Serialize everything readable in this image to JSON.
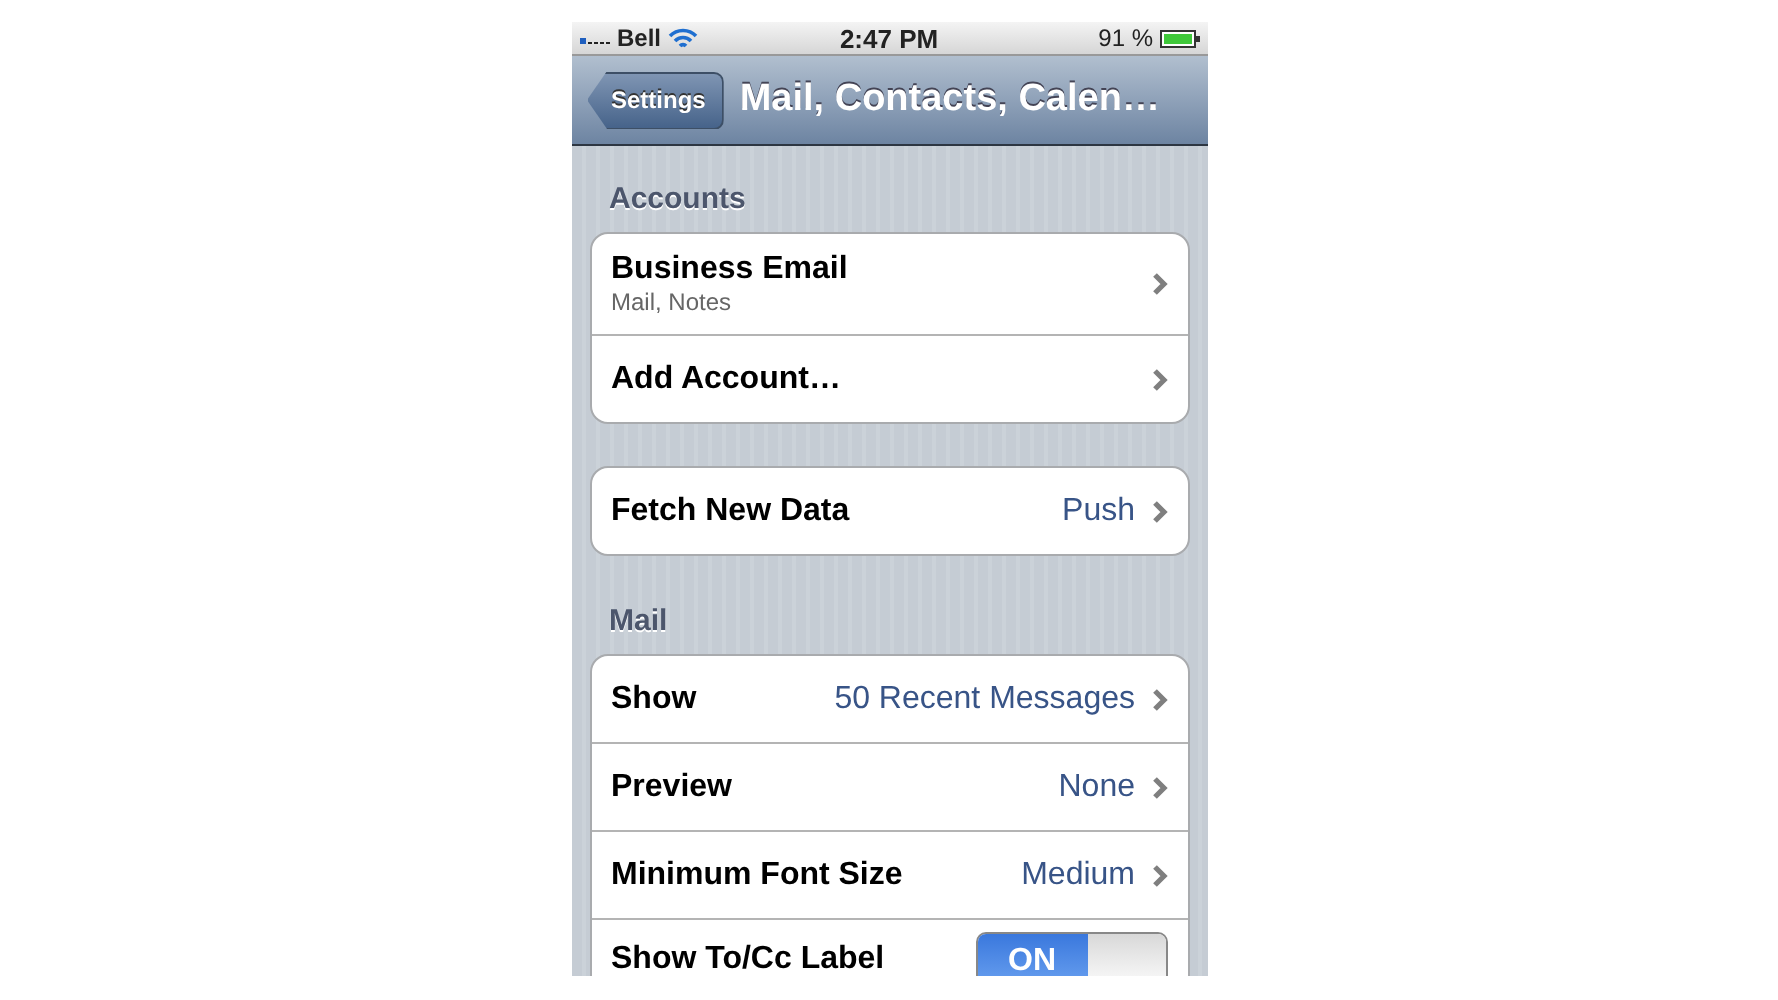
{
  "status_bar": {
    "carrier": "Bell",
    "time": "2:47 PM",
    "battery": "91 %"
  },
  "nav_bar": {
    "back": "Settings",
    "title": "Mail, Contacts, Calen…"
  },
  "sections": [
    {
      "header": "Accounts",
      "rows": [
        {
          "kind": "link",
          "label": "Business Email",
          "subtitle": "Mail, Notes"
        },
        {
          "kind": "link",
          "label": "Add Account…"
        }
      ]
    },
    {
      "rows": [
        {
          "kind": "link",
          "label": "Fetch New Data",
          "value": "Push"
        }
      ]
    },
    {
      "header": "Mail",
      "rows": [
        {
          "kind": "link",
          "label": "Show",
          "value": "50 Recent Messages"
        },
        {
          "kind": "link",
          "label": "Preview",
          "value": "None"
        },
        {
          "kind": "link",
          "label": "Minimum Font Size",
          "value": "Medium"
        },
        {
          "kind": "toggle",
          "label": "Show To/Cc Label",
          "on": true,
          "toggle_text": "ON"
        }
      ]
    }
  ]
}
